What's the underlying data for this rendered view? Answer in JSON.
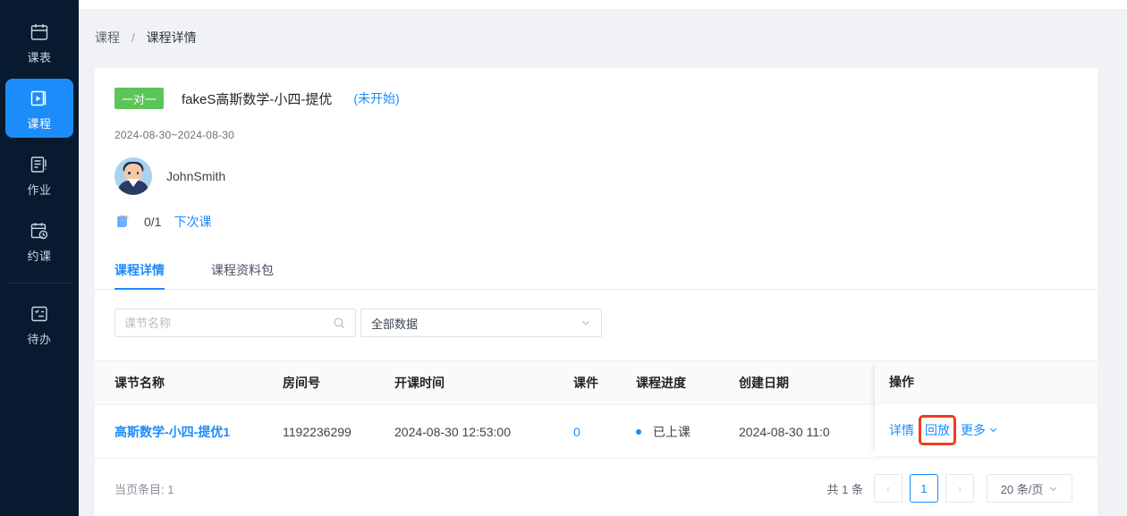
{
  "sidebar": {
    "items": [
      {
        "label": "课表",
        "icon": "calendar-icon",
        "active": false
      },
      {
        "label": "课程",
        "icon": "course-play-icon",
        "active": true
      },
      {
        "label": "作业",
        "icon": "homework-icon",
        "active": false
      },
      {
        "label": "约课",
        "icon": "booking-clock-icon",
        "active": false
      },
      {
        "label": "待办",
        "icon": "todo-checklist-icon",
        "active": false
      }
    ],
    "divider_after_index": 3,
    "background": "#071a2f",
    "active_color": "#1b8cf9"
  },
  "breadcrumb": {
    "parent": "课程",
    "separator": "/",
    "current": "课程详情"
  },
  "course": {
    "badge": "一对一",
    "badge_color": "#5cc558",
    "name": "fakeS高斯数学-小四-提优",
    "status": "(未开始)",
    "status_color": "#1b8cf9",
    "date_range": "2024-08-30~2024-08-30",
    "teacher": "JohnSmith",
    "lesson_progress": "0/1",
    "next_class_link": "下次课"
  },
  "tabs": [
    {
      "label": "课程详情",
      "active": true
    },
    {
      "label": "课程资料包",
      "active": false
    }
  ],
  "filters": {
    "search_placeholder": "课节名称",
    "search_value": "",
    "select_value": "全部数据"
  },
  "table": {
    "columns": [
      "课节名称",
      "房间号",
      "开课时间",
      "课件",
      "课程进度",
      "创建日期",
      "操作"
    ],
    "rows": [
      {
        "name": "高斯数学-小四-提优1",
        "room": "1192236299",
        "start_time": "2024-08-30 12:53:00",
        "courseware": "0",
        "progress": "已上课",
        "progress_dot_color": "#1b8cf9",
        "created": "2024-08-30 11:0",
        "actions": [
          "详情",
          "回放",
          "更多"
        ],
        "highlighted_action": "回放",
        "highlight_color": "#ef3e1b"
      }
    ]
  },
  "footer": {
    "page_items": "当页条目: 1",
    "total": "共 1 条",
    "prev": "‹",
    "pages": [
      "1"
    ],
    "next": "›",
    "page_size": "20 条/页"
  }
}
